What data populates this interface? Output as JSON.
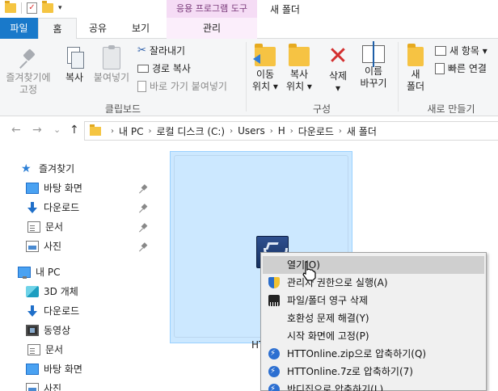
{
  "title_bar": {
    "context_tools": "응용 프로그램 도구",
    "window_title": "새 폴더"
  },
  "tabs": {
    "file": "파일",
    "home": "홈",
    "share": "공유",
    "view": "보기",
    "manage": "관리"
  },
  "ribbon": {
    "clipboard": {
      "pin_quick_access": "즐겨찾기에\n고정",
      "copy": "복사",
      "paste": "붙여넣기",
      "cut": "잘라내기",
      "copy_path": "경로 복사",
      "paste_shortcut": "바로 가기 붙여넣기",
      "group_label": "클립보드"
    },
    "organize": {
      "move_to_1": "이동",
      "move_to_2": "위치 ▾",
      "copy_to_1": "복사",
      "copy_to_2": "위치 ▾",
      "delete_1": "삭제",
      "delete_2": "▾",
      "rename_1": "이름",
      "rename_2": "바꾸기",
      "group_label": "구성"
    },
    "new": {
      "new_folder_1": "새",
      "new_folder_2": "폴더",
      "new_item": "새 항목 ▾",
      "easy_access": "빠른 연결",
      "group_label": "새로 만들기"
    }
  },
  "address": {
    "nav_back": "←",
    "nav_forward": "→",
    "nav_recent": "⌄",
    "nav_up": "↑",
    "crumbs": [
      "내 PC",
      "로컬 디스크 (C:)",
      "Users",
      "H",
      "다운로드",
      "새 폴더"
    ]
  },
  "nav_pane": {
    "quick_access": "즐겨찾기",
    "quick_items": [
      "바탕 화면",
      "다운로드",
      "문서",
      "사진"
    ],
    "this_pc": "내 PC",
    "pc_items": [
      "3D 개체",
      "다운로드",
      "동영상",
      "문서",
      "바탕 화면",
      "사진"
    ]
  },
  "content": {
    "file_label": "HTTO"
  },
  "context_menu": {
    "items": [
      "열기(O)",
      "관리자 권한으로 실행(A)",
      "파일/폴더 영구 삭제",
      "호환성 문제 해결(Y)",
      "시작 화면에 고정(P)",
      "HTTOnline.zip으로 압축하기(Q)",
      "HTTOnline.7z로 압축하기(7)",
      "반디집으로 압축하기(L)"
    ]
  },
  "icons": {
    "quick_access": "star-icon",
    "desktop": "desktop-icon",
    "downloads": "download-icon",
    "documents": "document-icon",
    "pictures": "pictures-icon",
    "this_pc": "computer-icon",
    "objects3d": "cube-icon",
    "videos": "video-icon",
    "admin": "shield-icon",
    "shred": "shredder-icon",
    "bandizip": "bandizip-icon"
  },
  "colors": {
    "file_tab": "#1979ca",
    "context_tab": "#f5dcf5",
    "selection": "#cce8ff",
    "menu_highlight": "#cfcfcf"
  }
}
